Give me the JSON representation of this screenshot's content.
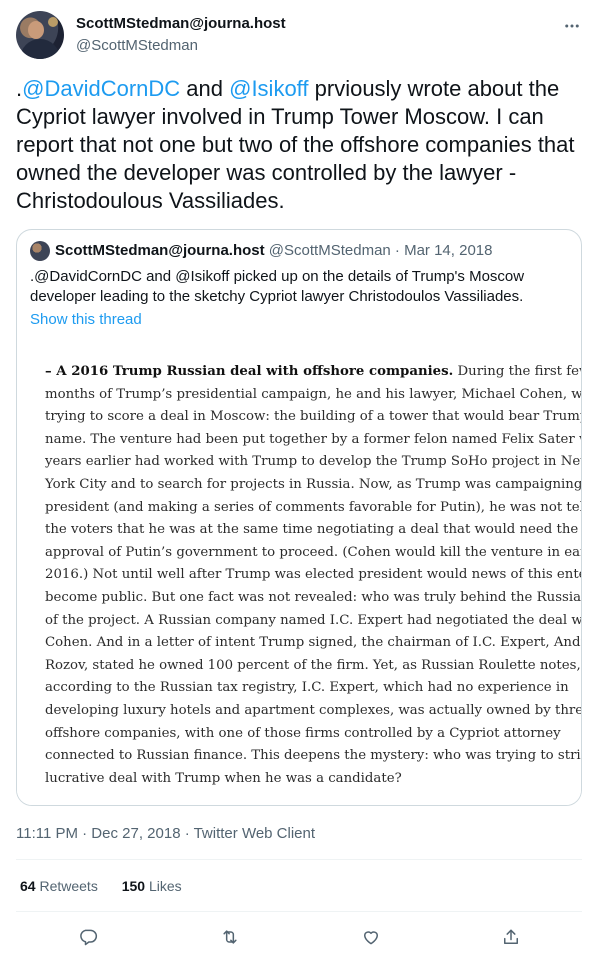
{
  "author": {
    "display_name": "ScottMStedman@journa.host",
    "handle": "@ScottMStedman"
  },
  "tweet": {
    "text_parts": {
      "prefix": ".",
      "mention1": "@DavidCornDC",
      "and": " and ",
      "mention2": "@Isikoff",
      "body": " prviously wrote about the Cypriot lawyer involved in Trump Tower Moscow. I can report that not one but two of the offshore companies that owned the developer was controlled by the lawyer - Christodoulous Vassiliades."
    },
    "timestamp": "11:11 PM · Dec 27, 2018 · Twitter Web Client"
  },
  "quote": {
    "display_name": "ScottMStedman@journa.host",
    "meta": " @ScottMStedman · Mar 14, 2018",
    "text": ".@DavidCornDC and @Isikoff picked up on the details of Trump's Moscow developer leading to the sketchy Cypriot lawyer Christodoulos Vassiliades.",
    "show_thread": "Show this thread",
    "excerpt": {
      "bold_lead": "– A 2016 Trump Russian deal with offshore companies.",
      "line0_rest": " During the first few",
      "lines": [
        "months of Trump’s presidential campaign, he and his lawyer, Michael Cohen, were",
        "trying to score a deal in Moscow: the building of a tower that would bear Trump’s",
        "name. The venture had been put together by a former felon named Felix Sater who",
        "years earlier had worked with Trump to develop the Trump SoHo project in New",
        "York City and to search for projects in Russia. Now, as Trump was campaigning for",
        "president (and making a series of comments favorable for Putin), he was not telling",
        "the voters that he was at the same time negotiating a deal that would need the",
        "approval of Putin’s government to proceed. (Cohen would kill the venture in early",
        "2016.) Not until well after Trump was elected president would news of this enterprise",
        "become public. But one fact was not revealed: who was truly behind the Russian side",
        "of the project. A Russian company named I.C. Expert had negotiated the deal with",
        "Cohen. And in a letter of intent Trump signed, the chairman of I.C. Expert, Andrey",
        "Rozov, stated he owned 100 percent of the firm. Yet, as Russian Roulette notes,",
        "according to the Russian tax registry, I.C. Expert, which had no experience in",
        "developing luxury hotels and apartment complexes, was actually owned by three",
        "offshore companies, with one of those firms controlled by a Cypriot attorney",
        "connected to Russian finance. This deepens the mystery: who was trying to strike a",
        "lucrative deal with Trump when he was a candidate?"
      ]
    }
  },
  "stats": {
    "retweets_count": "64",
    "retweets_label": " Retweets",
    "likes_count": "150",
    "likes_label": " Likes"
  },
  "actions": {
    "reply_icon": "reply-icon",
    "retweet_icon": "retweet-icon",
    "like_icon": "heart-icon",
    "share_icon": "share-icon"
  },
  "colors": {
    "accent": "#1d9bf0",
    "secondary_text": "#536471",
    "border": "#cfd9de"
  }
}
